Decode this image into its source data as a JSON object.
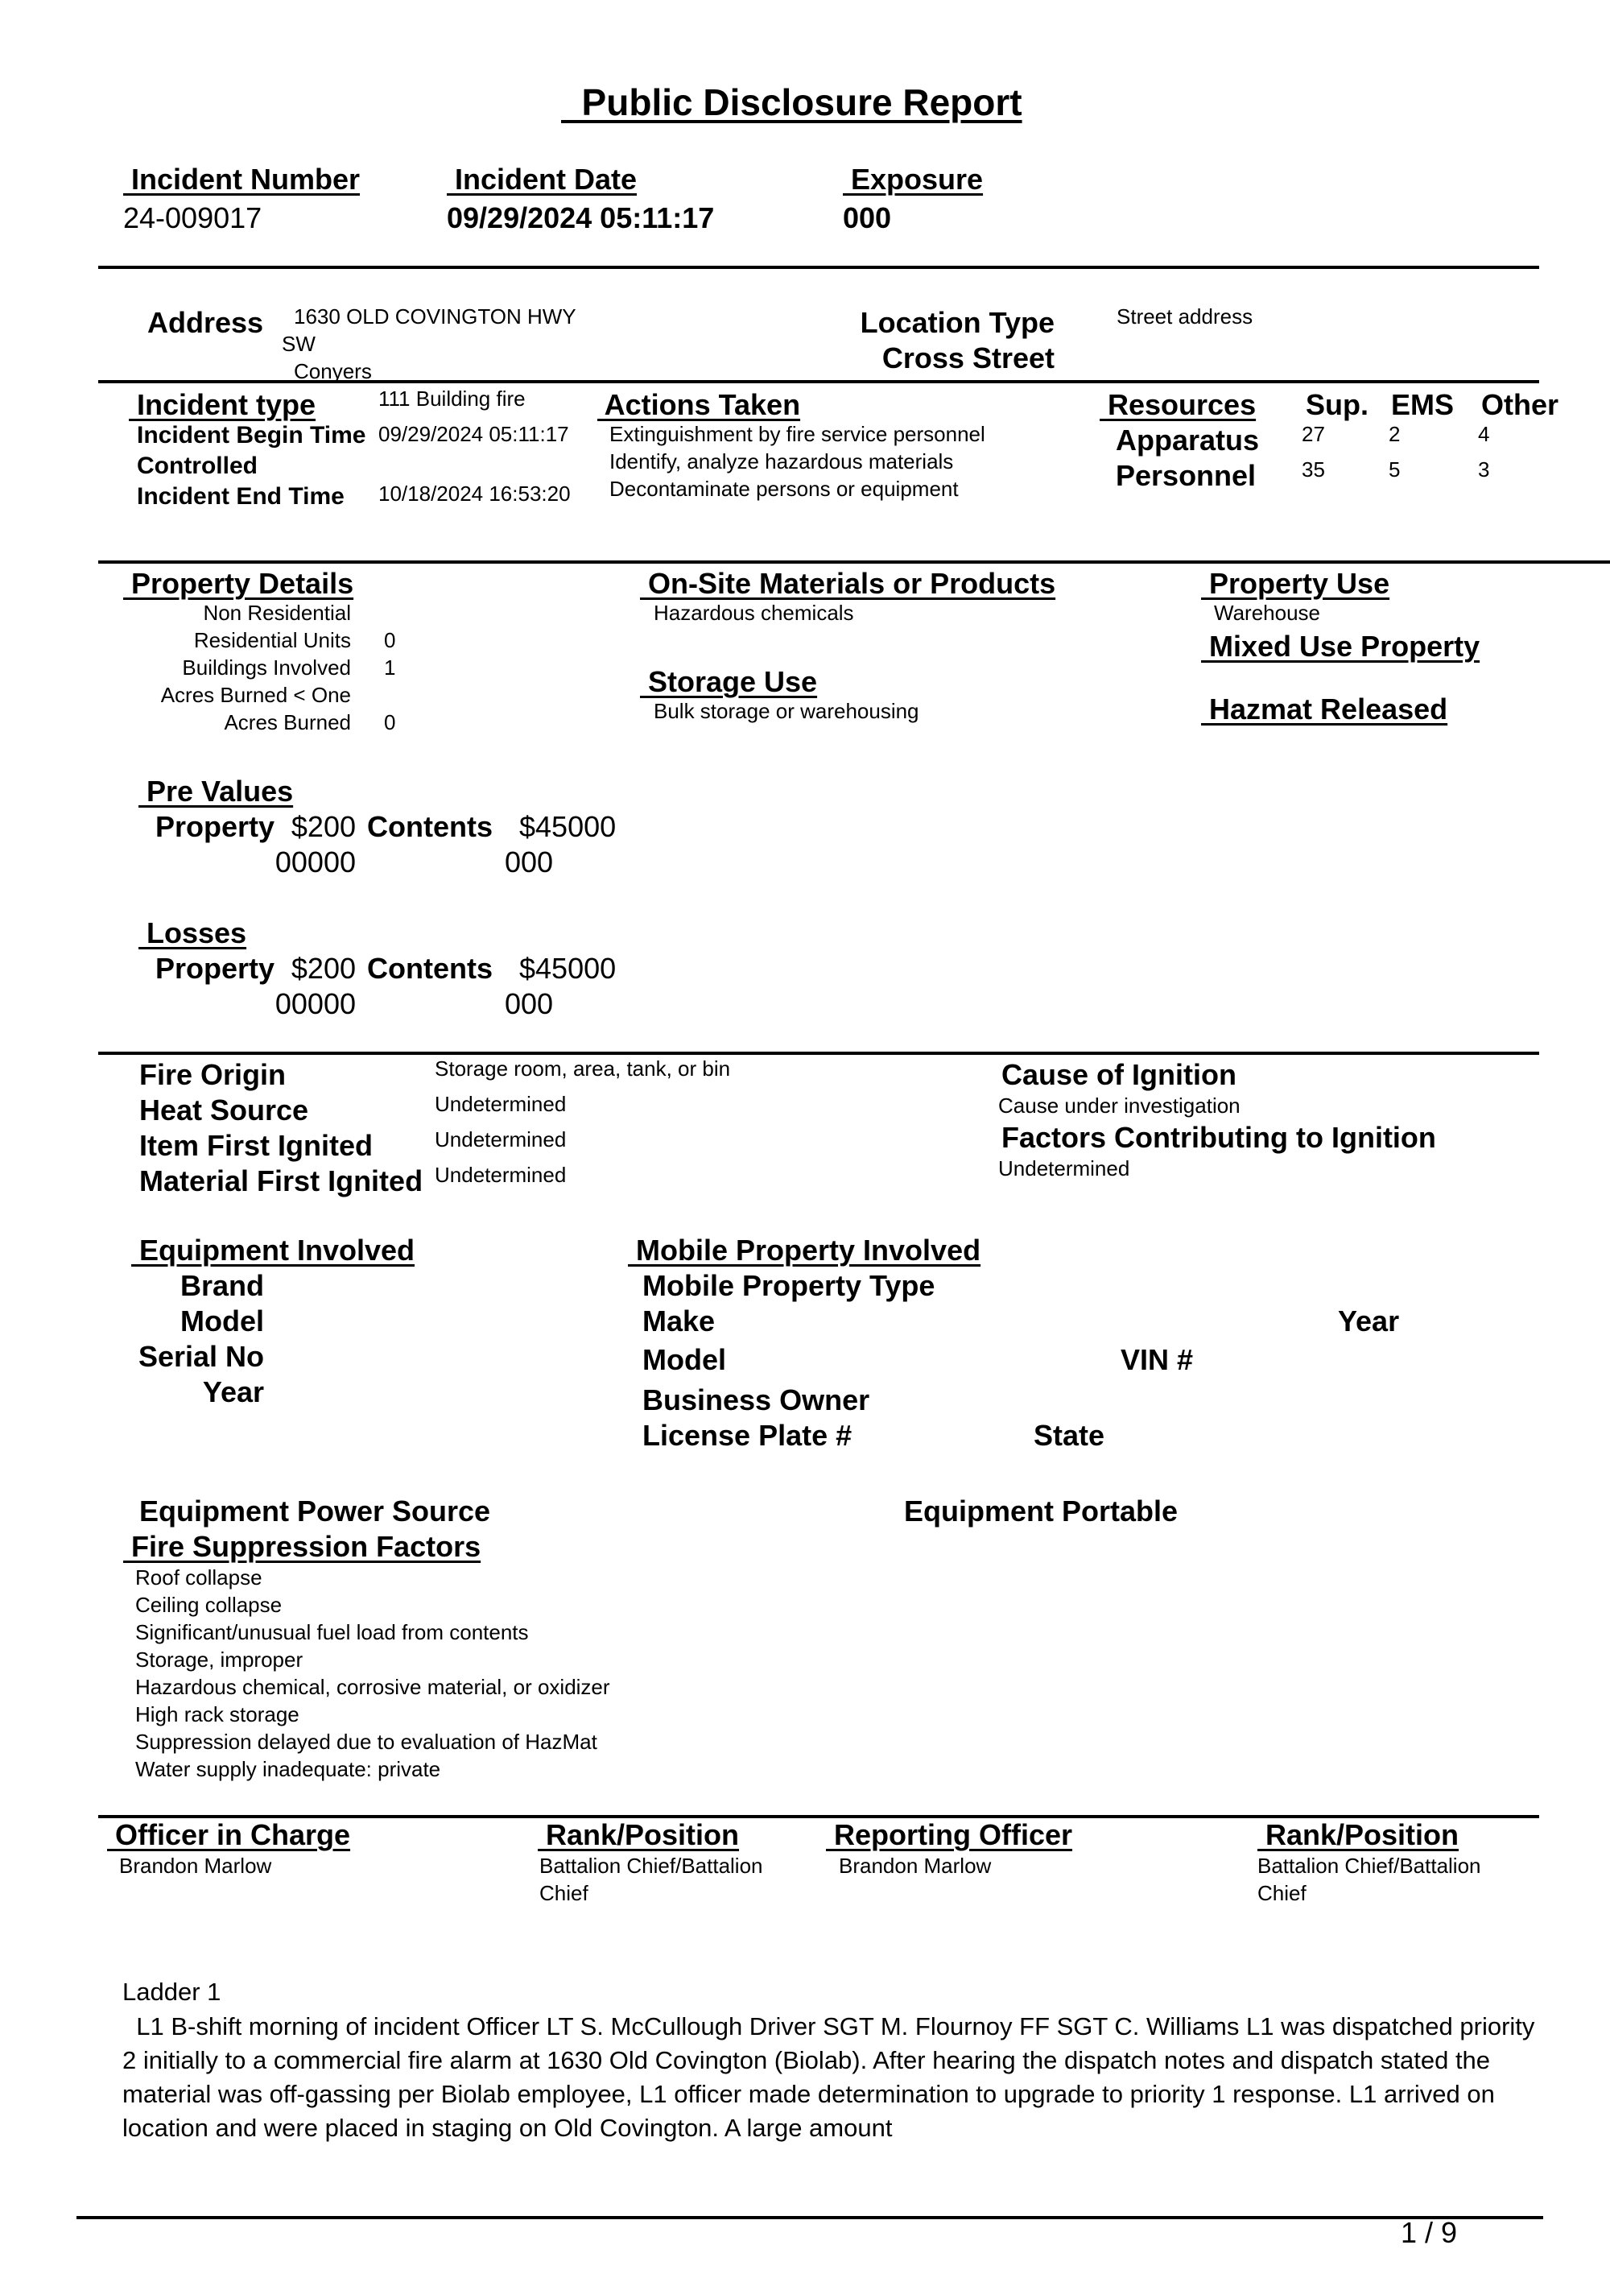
{
  "title": "  Public Disclosure Report",
  "header": {
    "incident_number_label": " Incident Number",
    "incident_number": "24-009017",
    "incident_date_label": " Incident Date",
    "incident_date": "09/29/2024 05:11:17",
    "exposure_label": " Exposure",
    "exposure": "000"
  },
  "location": {
    "address_label": "Address",
    "address_line1": "1630 OLD COVINGTON HWY",
    "address_line2": "SW",
    "city": "Conyers",
    "location_type_label": "Location Type",
    "location_type": "Street address",
    "cross_street_label": "Cross Street",
    "cross_street": ""
  },
  "incident": {
    "type_label": " Incident type",
    "type": "111 Building fire",
    "begin_label": "Incident Begin Time",
    "begin": "09/29/2024 05:11:17",
    "controlled_label": "Controlled",
    "controlled": "",
    "end_label": "Incident End Time",
    "end": "10/18/2024 16:53:20"
  },
  "actions": {
    "label": " Actions Taken",
    "items": [
      "Extinguishment by fire service personnel",
      "Identify, analyze hazardous materials",
      "Decontaminate persons or equipment"
    ]
  },
  "resources": {
    "label": " Resources",
    "columns": [
      "Sup.",
      "EMS",
      "Other"
    ],
    "rows": [
      {
        "label": "Apparatus",
        "values": [
          "27",
          "2",
          "4"
        ]
      },
      {
        "label": "Personnel",
        "values": [
          "35",
          "5",
          "3"
        ]
      }
    ]
  },
  "property_details": {
    "label": " Property Details",
    "rows": [
      {
        "label": "Non Residential",
        "value": ""
      },
      {
        "label": "Residential Units",
        "value": "0"
      },
      {
        "label": "Buildings Involved",
        "value": "1"
      },
      {
        "label": "Acres Burned < One",
        "value": ""
      },
      {
        "label": "Acres Burned",
        "value": "0"
      }
    ]
  },
  "onsite": {
    "label": " On-Site Materials or Products",
    "value": "Hazardous chemicals",
    "storage_label": " Storage Use",
    "storage_value": "Bulk storage or warehousing"
  },
  "property_use": {
    "label": " Property Use",
    "value": "Warehouse",
    "mixed_label": " Mixed Use Property",
    "hazmat_label": " Hazmat Released"
  },
  "pre_values": {
    "label": " Pre Values",
    "property_label": "Property",
    "property_line1": "$200",
    "property_line2": "00000",
    "contents_label": "Contents",
    "contents_line1": "$45000",
    "contents_line2": "000"
  },
  "losses": {
    "label": " Losses",
    "property_label": "Property",
    "property_line1": "$200",
    "property_line2": "00000",
    "contents_label": "Contents",
    "contents_line1": "$45000",
    "contents_line2": "000"
  },
  "ignition": {
    "rows": [
      {
        "label": "Fire Origin",
        "value": "Storage room, area, tank, or bin"
      },
      {
        "label": "Heat Source",
        "value": "Undetermined"
      },
      {
        "label": "Item First Ignited",
        "value": "Undetermined"
      },
      {
        "label": "Material First Ignited",
        "value": "Undetermined"
      }
    ],
    "cause_label": "Cause of Ignition",
    "cause_value": "Cause under investigation",
    "factors_label": "Factors Contributing to Ignition",
    "factors_value": "Undetermined"
  },
  "equipment": {
    "label": " Equipment Involved",
    "brand_label": "Brand",
    "model_label": "Model",
    "serial_label": "Serial No",
    "year_label": "Year",
    "power_source_label": "Equipment Power Source",
    "portable_label": "Equipment Portable"
  },
  "mobile": {
    "label": " Mobile Property Involved",
    "type_label": "Mobile Property Type",
    "make_label": "Make",
    "year_label": "Year",
    "model_label": "Model",
    "vin_label": "VIN #",
    "owner_label": "Business Owner",
    "plate_label": "License Plate #",
    "state_label": "State"
  },
  "suppression": {
    "label": " Fire Suppression Factors",
    "items": [
      "Roof collapse",
      "Ceiling collapse",
      "Significant/unusual fuel load from contents",
      "Storage, improper",
      "Hazardous chemical, corrosive material, or oxidizer",
      "High rack storage",
      "Suppression delayed due to evaluation of HazMat",
      "Water supply inadequate: private"
    ]
  },
  "officers": {
    "in_charge_label": " Officer in Charge",
    "in_charge": "Brandon Marlow",
    "rank1_label": " Rank/Position",
    "rank1_line1": " Battalion Chief/Battalion",
    "rank1_line2": "Chief",
    "reporting_label": " Reporting Officer",
    "reporting": "Brandon Marlow",
    "rank2_label": " Rank/Position",
    "rank2_line1": " Battalion Chief/Battalion",
    "rank2_line2": "Chief"
  },
  "narrative": {
    "heading": "Ladder 1",
    "text": "  L1 B-shift morning of incident Officer LT S. McCullough Driver SGT M. Flournoy FF SGT C. Williams L1 was dispatched priority 2 initially to a commercial fire alarm at 1630 Old Covington (Biolab). After hearing the dispatch notes and dispatch stated the material was off-gassing per Biolab employee, L1 officer made determination to upgrade to priority 1 response. L1 arrived on location and were placed in staging on Old Covington. A large amount"
  },
  "footer": {
    "page": "1 / 9"
  }
}
